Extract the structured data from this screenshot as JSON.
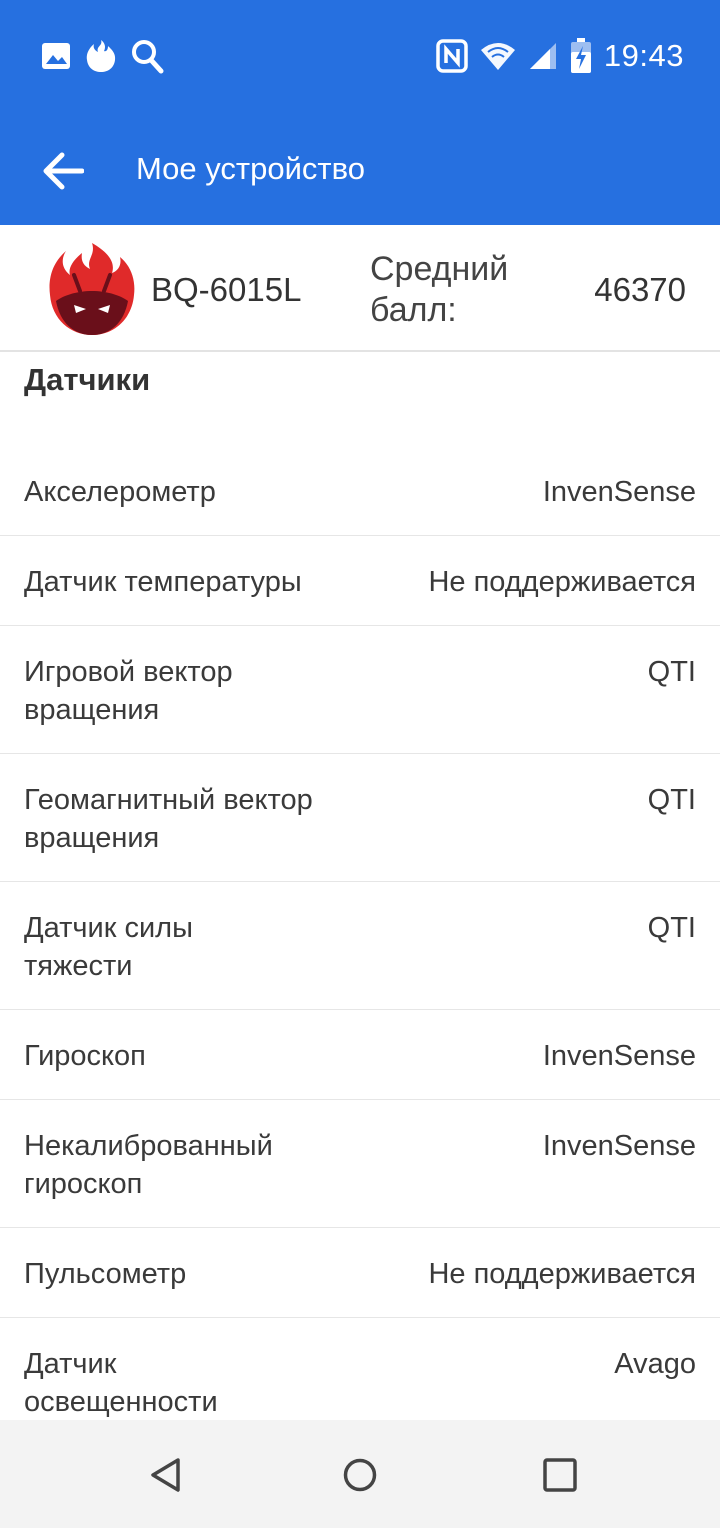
{
  "status_bar": {
    "time": "19:43",
    "left_icons": [
      "image-icon",
      "flame-icon",
      "search-icon"
    ],
    "right_icons": [
      "nfc-icon",
      "wifi-icon",
      "signal-icon",
      "battery-charging-icon"
    ]
  },
  "app_bar": {
    "title": "Мое устройство",
    "back_icon": "arrow-back-icon"
  },
  "device": {
    "model": "BQ-6015L",
    "score_label": "Средний балл:",
    "score_value": "46370",
    "logo_icon": "antutu-logo-icon"
  },
  "section": {
    "title": "Датчики"
  },
  "sensors": [
    {
      "label": "Акселерометр",
      "value": "InvenSense"
    },
    {
      "label": "Датчик температуры",
      "value": "Не поддерживается"
    },
    {
      "label": "Игровой вектор вращения",
      "value": "QTI"
    },
    {
      "label": "Геомагнитный вектор вращения",
      "value": "QTI"
    },
    {
      "label": "Датчик силы тяжести",
      "value": "QTI"
    },
    {
      "label": "Гироскоп",
      "value": "InvenSense"
    },
    {
      "label": "Некалиброванный гироскоп",
      "value": "InvenSense"
    },
    {
      "label": "Пульсометр",
      "value": "Не поддерживается"
    },
    {
      "label": "Датчик освещенности",
      "value": "Avago"
    }
  ],
  "nav_bar": {
    "icons": [
      "nav-back-icon",
      "nav-home-icon",
      "nav-recents-icon"
    ]
  },
  "colors": {
    "primary": "#2670e0",
    "logo_red": "#e02a2a",
    "logo_dark": "#6a0f1a"
  }
}
